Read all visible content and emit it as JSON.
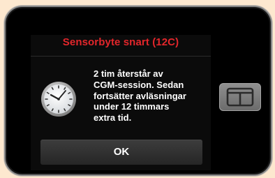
{
  "dialog": {
    "title": "Sensorbyte snart (12C)",
    "message": "2 tim återstår av\nCGM-session. Sedan\nfortsätter avläsningar\nunder 12 timmars\nextra tid.",
    "ok_label": "OK",
    "title_color": "#e3262b",
    "icon": "clock-icon"
  },
  "device": {
    "home_button_icon": "t-logo-icon"
  }
}
